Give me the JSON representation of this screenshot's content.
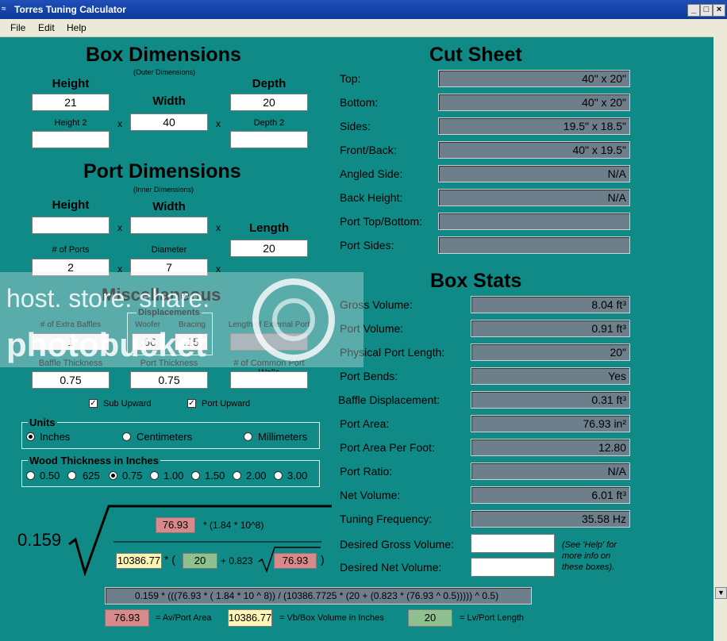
{
  "window": {
    "title": "Torres Tuning Calculator"
  },
  "menu": {
    "items": [
      "File",
      "Edit",
      "Help"
    ]
  },
  "box_dimensions": {
    "title": "Box Dimensions",
    "subtitle": "(Outer Dimensions)",
    "height_label": "Height",
    "width_label": "Width",
    "depth_label": "Depth",
    "height_value": "21",
    "width_value": "40",
    "depth_value": "20",
    "height2_label": "Height 2",
    "depth2_label": "Depth 2",
    "x": "x"
  },
  "port_dimensions": {
    "title": "Port Dimensions",
    "subtitle": "(Inner Dimensions)",
    "height_label": "Height",
    "width_label": "Width",
    "length_label": "Length",
    "length_value": "20",
    "ports_label": "# of Ports",
    "diameter_label": "Diameter",
    "ports_value": "2",
    "diameter_value": "7"
  },
  "misc": {
    "title": "Miscellaneous",
    "extra_baffles_label": "# of Extra Baffles",
    "extra_baffles_value": "1",
    "displacements_label": "Displacements",
    "woofer_label": "Woofer",
    "bracing_label": "Bracing",
    "woofer_value": ".66",
    "bracing_value": ".15",
    "ext_port_label": "Length of External Port",
    "baffle_thickness_label": "Baffle Thickness",
    "port_thickness_label": "Port Thickness",
    "common_port_walls_label": "# of Common Port Walls",
    "baffle_thickness_value": "0.75",
    "port_thickness_value": "0.75",
    "sub_upward_label": "Sub Upward",
    "port_upward_label": "Port Upward"
  },
  "units": {
    "title": "Units",
    "options": [
      "Inches",
      "Centimeters",
      "Millimeters"
    ],
    "selected": "Inches"
  },
  "wood": {
    "title": "Wood Thickness in Inches",
    "options": [
      "0.50",
      "625",
      "0.75",
      "1.00",
      "1.50",
      "2.00",
      "3.00"
    ],
    "selected": "0.75"
  },
  "cut_sheet": {
    "title": "Cut Sheet",
    "rows": [
      {
        "label": "Top:",
        "value": "40\" x 20\""
      },
      {
        "label": "Bottom:",
        "value": "40\" x 20\""
      },
      {
        "label": "Sides:",
        "value": "19.5\" x 18.5\""
      },
      {
        "label": "Front/Back:",
        "value": "40\" x 19.5\""
      },
      {
        "label": "Angled Side:",
        "value": "N/A"
      },
      {
        "label": "Back Height:",
        "value": "N/A"
      },
      {
        "label": "Port Top/Bottom:",
        "value": ""
      },
      {
        "label": "Port Sides:",
        "value": ""
      }
    ]
  },
  "box_stats": {
    "title": "Box Stats",
    "rows": [
      {
        "label": "Gross Volume:",
        "value": "8.04 ft³"
      },
      {
        "label": "Port Volume:",
        "value": "0.91 ft³"
      },
      {
        "label": "Physical Port Length:",
        "value": "20\""
      },
      {
        "label": "Port Bends:",
        "value": "Yes"
      },
      {
        "label": "Baffle Displacement:",
        "value": "0.31 ft³"
      },
      {
        "label": "Port Area:",
        "value": "76.93 in²"
      },
      {
        "label": "Port Area Per Foot:",
        "value": "12.80"
      },
      {
        "label": "Port Ratio:",
        "value": "N/A"
      },
      {
        "label": "Net Volume:",
        "value": "6.01 ft³"
      },
      {
        "label": "Tuning Frequency:",
        "value": "35.58 Hz"
      }
    ],
    "desired_gross_label": "Desired Gross Volume:",
    "desired_net_label": "Desired Net Volume:",
    "help_note": "(See 'Help' for more info on these boxes)."
  },
  "formula": {
    "coef": "0.159",
    "av": "76.93",
    "num_tail": "* (1.84 * 10^8)",
    "vb": "10386.77",
    "star_paren": "* (",
    "lv": "20",
    "plus": "+ 0.823",
    "av2": "76.93",
    "close": ")",
    "expr": "0.159 * (((76.93 * ( 1.84 * 10 ^ 8)) / (10386.7725 * (20 + (0.823 * (76.93 ^ 0.5))))) ^ 0.5)",
    "legend_av": "76.93",
    "legend_av_label": "= Av/Port Area",
    "legend_vb": "10386.77",
    "legend_vb_label": "= Vb/Box Volume in Inches",
    "legend_lv": "20",
    "legend_lv_label": "= Lv/Port Length"
  },
  "watermark": {
    "text": "host. store. share.",
    "brand": "photobucket"
  }
}
